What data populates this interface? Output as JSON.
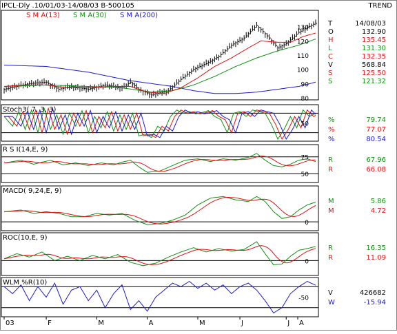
{
  "header": {
    "symbol_line": "IPCL-Dly .10/01/03-14/08/03 B-500105",
    "trend_label": "TREND"
  },
  "colors": {
    "black": "#000000",
    "sma13": "#e01010",
    "sma30": "#109010",
    "sma200": "#1a1acc",
    "price": "#000000",
    "ind_green": "#109010",
    "ind_red": "#e01010",
    "ind_blue": "#1a1acc"
  },
  "chart_data": [
    {
      "panel": "price",
      "type": "ohlc",
      "legend": [
        {
          "name": "S M A(13)",
          "color": "sma13"
        },
        {
          "name": "S M A(30)",
          "color": "sma30"
        },
        {
          "name": "S M A(200)",
          "color": "sma200"
        }
      ],
      "ylim": [
        80,
        140
      ],
      "yticks": [
        80,
        90,
        100,
        110,
        120,
        130
      ],
      "readout": [
        {
          "key": "T",
          "value": "14/08/03",
          "color": "black"
        },
        {
          "key": "O",
          "value": "132.90",
          "color": "black"
        },
        {
          "key": "H",
          "value": "135.45",
          "color": "sma13"
        },
        {
          "key": "L",
          "value": "131.30",
          "color": "sma30"
        },
        {
          "key": "C",
          "value": "132.35",
          "color": "sma13"
        },
        {
          "key": "V",
          "value": "568.84",
          "color": "black"
        },
        {
          "key": "S",
          "value": "125.50",
          "color": "sma13"
        },
        {
          "key": "S",
          "value": "121.32",
          "color": "sma30"
        }
      ],
      "close_anchors": [
        [
          0,
          86
        ],
        [
          6,
          88
        ],
        [
          12,
          90
        ],
        [
          20,
          91
        ],
        [
          26,
          86
        ],
        [
          32,
          88
        ],
        [
          40,
          86
        ],
        [
          48,
          89
        ],
        [
          56,
          87
        ],
        [
          60,
          91
        ],
        [
          64,
          86
        ],
        [
          70,
          82
        ],
        [
          78,
          85
        ],
        [
          84,
          93
        ],
        [
          90,
          100
        ],
        [
          96,
          104
        ],
        [
          102,
          109
        ],
        [
          108,
          117
        ],
        [
          114,
          122
        ],
        [
          120,
          131
        ],
        [
          126,
          122
        ],
        [
          130,
          115
        ],
        [
          134,
          118
        ],
        [
          140,
          126
        ],
        [
          146,
          131
        ],
        [
          148,
          132.35
        ]
      ],
      "sma13_anchors": [
        [
          0,
          88
        ],
        [
          10,
          89
        ],
        [
          20,
          89
        ],
        [
          30,
          87
        ],
        [
          40,
          87
        ],
        [
          50,
          88
        ],
        [
          60,
          88
        ],
        [
          68,
          84
        ],
        [
          76,
          83
        ],
        [
          84,
          87
        ],
        [
          92,
          94
        ],
        [
          100,
          102
        ],
        [
          108,
          108
        ],
        [
          116,
          115
        ],
        [
          122,
          120
        ],
        [
          130,
          119
        ],
        [
          136,
          119
        ],
        [
          142,
          123
        ],
        [
          148,
          125.5
        ]
      ],
      "sma30_anchors": [
        [
          0,
          88
        ],
        [
          20,
          89
        ],
        [
          40,
          88
        ],
        [
          56,
          87
        ],
        [
          70,
          84
        ],
        [
          80,
          85
        ],
        [
          90,
          89
        ],
        [
          100,
          95
        ],
        [
          110,
          102
        ],
        [
          120,
          108
        ],
        [
          130,
          113
        ],
        [
          140,
          117
        ],
        [
          148,
          121.32
        ]
      ],
      "sma200_anchors": [
        [
          0,
          103
        ],
        [
          20,
          102
        ],
        [
          40,
          98
        ],
        [
          60,
          92
        ],
        [
          80,
          88
        ],
        [
          90,
          85
        ],
        [
          100,
          83
        ],
        [
          110,
          83
        ],
        [
          120,
          84
        ],
        [
          130,
          86
        ],
        [
          140,
          88
        ],
        [
          148,
          91
        ]
      ]
    },
    {
      "panel": "stochastic",
      "type": "line",
      "title": "Stoch3( 7, 3, 3)",
      "ylim": [
        0,
        100
      ],
      "yticks": [
        50
      ],
      "guides": [
        80,
        20
      ],
      "readout": [
        {
          "key": "%",
          "value": "79.74",
          "color": "ind_green"
        },
        {
          "key": "%",
          "value": "77.07",
          "color": "ind_red"
        },
        {
          "key": "%",
          "value": "80.54",
          "color": "ind_blue"
        }
      ],
      "anchors": [
        [
          0,
          70
        ],
        [
          4,
          40
        ],
        [
          7,
          85
        ],
        [
          10,
          30
        ],
        [
          13,
          90
        ],
        [
          16,
          20
        ],
        [
          19,
          95
        ],
        [
          22,
          30
        ],
        [
          25,
          75
        ],
        [
          28,
          15
        ],
        [
          31,
          80
        ],
        [
          34,
          40
        ],
        [
          37,
          88
        ],
        [
          40,
          20
        ],
        [
          43,
          70
        ],
        [
          46,
          35
        ],
        [
          49,
          85
        ],
        [
          52,
          25
        ],
        [
          55,
          75
        ],
        [
          58,
          30
        ],
        [
          61,
          80
        ],
        [
          64,
          10
        ],
        [
          67,
          15
        ],
        [
          70,
          5
        ],
        [
          73,
          40
        ],
        [
          76,
          25
        ],
        [
          79,
          70
        ],
        [
          82,
          90
        ],
        [
          85,
          80
        ],
        [
          88,
          85
        ],
        [
          91,
          78
        ],
        [
          94,
          82
        ],
        [
          97,
          88
        ],
        [
          100,
          70
        ],
        [
          103,
          60
        ],
        [
          106,
          20
        ],
        [
          109,
          80
        ],
        [
          112,
          85
        ],
        [
          115,
          70
        ],
        [
          118,
          90
        ],
        [
          121,
          85
        ],
        [
          124,
          80
        ],
        [
          127,
          45
        ],
        [
          130,
          0
        ],
        [
          133,
          30
        ],
        [
          136,
          70
        ],
        [
          139,
          35
        ],
        [
          142,
          90
        ],
        [
          145,
          70
        ],
        [
          148,
          80
        ]
      ]
    },
    {
      "panel": "rsi",
      "type": "line",
      "title": "R S I(14,E, 9)",
      "ylim": [
        40,
        90
      ],
      "yticks": [
        75,
        50
      ],
      "guides": [
        75,
        50
      ],
      "readout": [
        {
          "key": "R",
          "value": "67.96",
          "color": "ind_green"
        },
        {
          "key": "R",
          "value": "66.08",
          "color": "ind_red"
        }
      ],
      "anchors": [
        [
          0,
          66
        ],
        [
          8,
          70
        ],
        [
          14,
          64
        ],
        [
          22,
          70
        ],
        [
          28,
          63
        ],
        [
          34,
          66
        ],
        [
          40,
          62
        ],
        [
          46,
          66
        ],
        [
          52,
          63
        ],
        [
          56,
          67
        ],
        [
          60,
          70
        ],
        [
          64,
          60
        ],
        [
          68,
          52
        ],
        [
          74,
          54
        ],
        [
          80,
          62
        ],
        [
          86,
          70
        ],
        [
          92,
          72
        ],
        [
          98,
          68
        ],
        [
          104,
          72
        ],
        [
          110,
          70
        ],
        [
          116,
          74
        ],
        [
          120,
          80
        ],
        [
          124,
          70
        ],
        [
          128,
          62
        ],
        [
          132,
          60
        ],
        [
          136,
          64
        ],
        [
          140,
          70
        ],
        [
          144,
          72
        ],
        [
          148,
          68
        ]
      ]
    },
    {
      "panel": "macd",
      "type": "line",
      "title": "MACD( 9,24,E, 9)",
      "ylim": [
        -2,
        10
      ],
      "yticks": [
        0
      ],
      "guides": [
        0
      ],
      "readout": [
        {
          "key": "M",
          "value": "5.86",
          "color": "ind_green"
        },
        {
          "key": "M",
          "value": "4.72",
          "color": "ind_red"
        }
      ],
      "anchors": [
        [
          0,
          3
        ],
        [
          8,
          3.5
        ],
        [
          14,
          2.5
        ],
        [
          20,
          3
        ],
        [
          26,
          2.5
        ],
        [
          32,
          1.5
        ],
        [
          38,
          1.5
        ],
        [
          44,
          2.5
        ],
        [
          50,
          2
        ],
        [
          56,
          2.5
        ],
        [
          62,
          0.5
        ],
        [
          68,
          -0.8
        ],
        [
          74,
          -0.5
        ],
        [
          80,
          0.5
        ],
        [
          86,
          2
        ],
        [
          92,
          5
        ],
        [
          98,
          7
        ],
        [
          104,
          7.5
        ],
        [
          110,
          6.5
        ],
        [
          116,
          6
        ],
        [
          120,
          7.5
        ],
        [
          124,
          6
        ],
        [
          128,
          3
        ],
        [
          132,
          1
        ],
        [
          136,
          1.5
        ],
        [
          140,
          3.5
        ],
        [
          144,
          5
        ],
        [
          148,
          5.86
        ]
      ]
    },
    {
      "panel": "roc",
      "type": "line",
      "title": "ROC(10,E, 9)",
      "ylim": [
        -15,
        30
      ],
      "yticks": [
        0
      ],
      "guides": [
        0
      ],
      "readout": [
        {
          "key": "R",
          "value": "16.35",
          "color": "ind_green"
        },
        {
          "key": "R",
          "value": "11.09",
          "color": "ind_red"
        }
      ],
      "anchors": [
        [
          0,
          2
        ],
        [
          6,
          8
        ],
        [
          12,
          4
        ],
        [
          18,
          10
        ],
        [
          24,
          0
        ],
        [
          30,
          5
        ],
        [
          36,
          0
        ],
        [
          42,
          6
        ],
        [
          48,
          2
        ],
        [
          54,
          7
        ],
        [
          60,
          -2
        ],
        [
          66,
          -6
        ],
        [
          72,
          -3
        ],
        [
          78,
          4
        ],
        [
          84,
          10
        ],
        [
          90,
          15
        ],
        [
          96,
          10
        ],
        [
          102,
          14
        ],
        [
          108,
          11
        ],
        [
          114,
          13
        ],
        [
          120,
          22
        ],
        [
          124,
          8
        ],
        [
          128,
          -5
        ],
        [
          132,
          -4
        ],
        [
          136,
          5
        ],
        [
          140,
          12
        ],
        [
          144,
          14
        ],
        [
          148,
          16.35
        ]
      ]
    },
    {
      "panel": "wlm",
      "type": "line",
      "title": "WLM %R(10)",
      "ylim": [
        -100,
        0
      ],
      "yticks": [
        -50
      ],
      "guides": [
        -20,
        -80
      ],
      "readout": [
        {
          "key": "V",
          "value": "426682",
          "color": "black"
        },
        {
          "key": "W",
          "value": "-15.94",
          "color": "ind_blue"
        }
      ],
      "anchors": [
        [
          0,
          -20
        ],
        [
          4,
          -40
        ],
        [
          8,
          -15
        ],
        [
          12,
          -60
        ],
        [
          16,
          -20
        ],
        [
          20,
          -50
        ],
        [
          24,
          -10
        ],
        [
          28,
          -70
        ],
        [
          32,
          -30
        ],
        [
          36,
          -20
        ],
        [
          40,
          -60
        ],
        [
          44,
          -30
        ],
        [
          48,
          -80
        ],
        [
          52,
          -40
        ],
        [
          56,
          -15
        ],
        [
          60,
          -85
        ],
        [
          64,
          -60
        ],
        [
          68,
          -90
        ],
        [
          72,
          -50
        ],
        [
          76,
          -30
        ],
        [
          80,
          -10
        ],
        [
          84,
          -20
        ],
        [
          88,
          -5
        ],
        [
          92,
          -25
        ],
        [
          96,
          -10
        ],
        [
          100,
          -30
        ],
        [
          104,
          -15
        ],
        [
          108,
          -40
        ],
        [
          112,
          -20
        ],
        [
          116,
          -10
        ],
        [
          120,
          -30
        ],
        [
          124,
          -60
        ],
        [
          128,
          -95
        ],
        [
          132,
          -80
        ],
        [
          136,
          -40
        ],
        [
          140,
          -20
        ],
        [
          144,
          -5
        ],
        [
          148,
          -16
        ]
      ]
    }
  ],
  "x_axis": {
    "labels": [
      "03",
      "F",
      "M",
      "A",
      "M",
      "J",
      "J",
      "A"
    ],
    "label_bars": [
      0,
      20,
      44,
      68,
      92,
      112,
      134,
      160
    ]
  }
}
